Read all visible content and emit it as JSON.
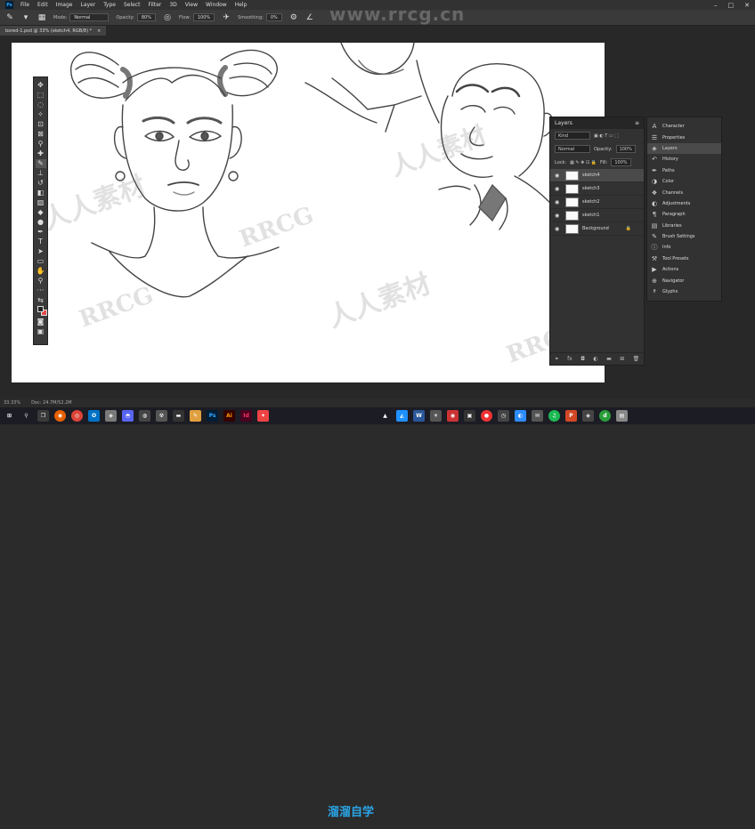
{
  "menubar": {
    "app_logo": "Ps",
    "items": [
      "File",
      "Edit",
      "Image",
      "Layer",
      "Type",
      "Select",
      "Filter",
      "3D",
      "View",
      "Window",
      "Help"
    ]
  },
  "options": {
    "mode_label": "Mode:",
    "mode_value": "Normal",
    "opacity_label": "Opacity:",
    "opacity_value": "80%",
    "flow_label": "Flow:",
    "flow_value": "100%",
    "smoothing_label": "Smoothing:",
    "smoothing_value": "0%"
  },
  "doc_tab": {
    "title": "bored-1.psd @ 33% (sketch4, RGB/8) *",
    "close": "×"
  },
  "watermark_top": "www.rrcg.cn",
  "layers": {
    "tab_label": "Layers",
    "filter_value": "Kind",
    "blend_value": "Normal",
    "opacity_label": "Opacity:",
    "opacity_value": "100%",
    "lock_label": "Lock:",
    "fill_label": "Fill:",
    "fill_value": "100%",
    "items": [
      {
        "name": "sketch4",
        "active": true
      },
      {
        "name": "sketch3",
        "active": false
      },
      {
        "name": "sketch2",
        "active": false
      },
      {
        "name": "sketch1",
        "active": false
      },
      {
        "name": "Background",
        "active": false
      }
    ]
  },
  "side_panels": {
    "items": [
      "Character",
      "Properties",
      "Layers",
      "History",
      "Paths",
      "Color",
      "Channels",
      "Adjustments",
      "Paragraph",
      "Libraries",
      "Brush Settings",
      "Info",
      "Tool Presets",
      "Actions",
      "Navigator",
      "Glyphs"
    ],
    "active_index": 2
  },
  "status": {
    "zoom": "33.33%",
    "doc": "Doc: 24.7M/52.2M"
  },
  "taskbar_logo": "溜溜自学",
  "colors": {
    "accent": "#31a8ff",
    "bg_swatch": "#e54a4a",
    "fg_swatch": "#222222"
  }
}
